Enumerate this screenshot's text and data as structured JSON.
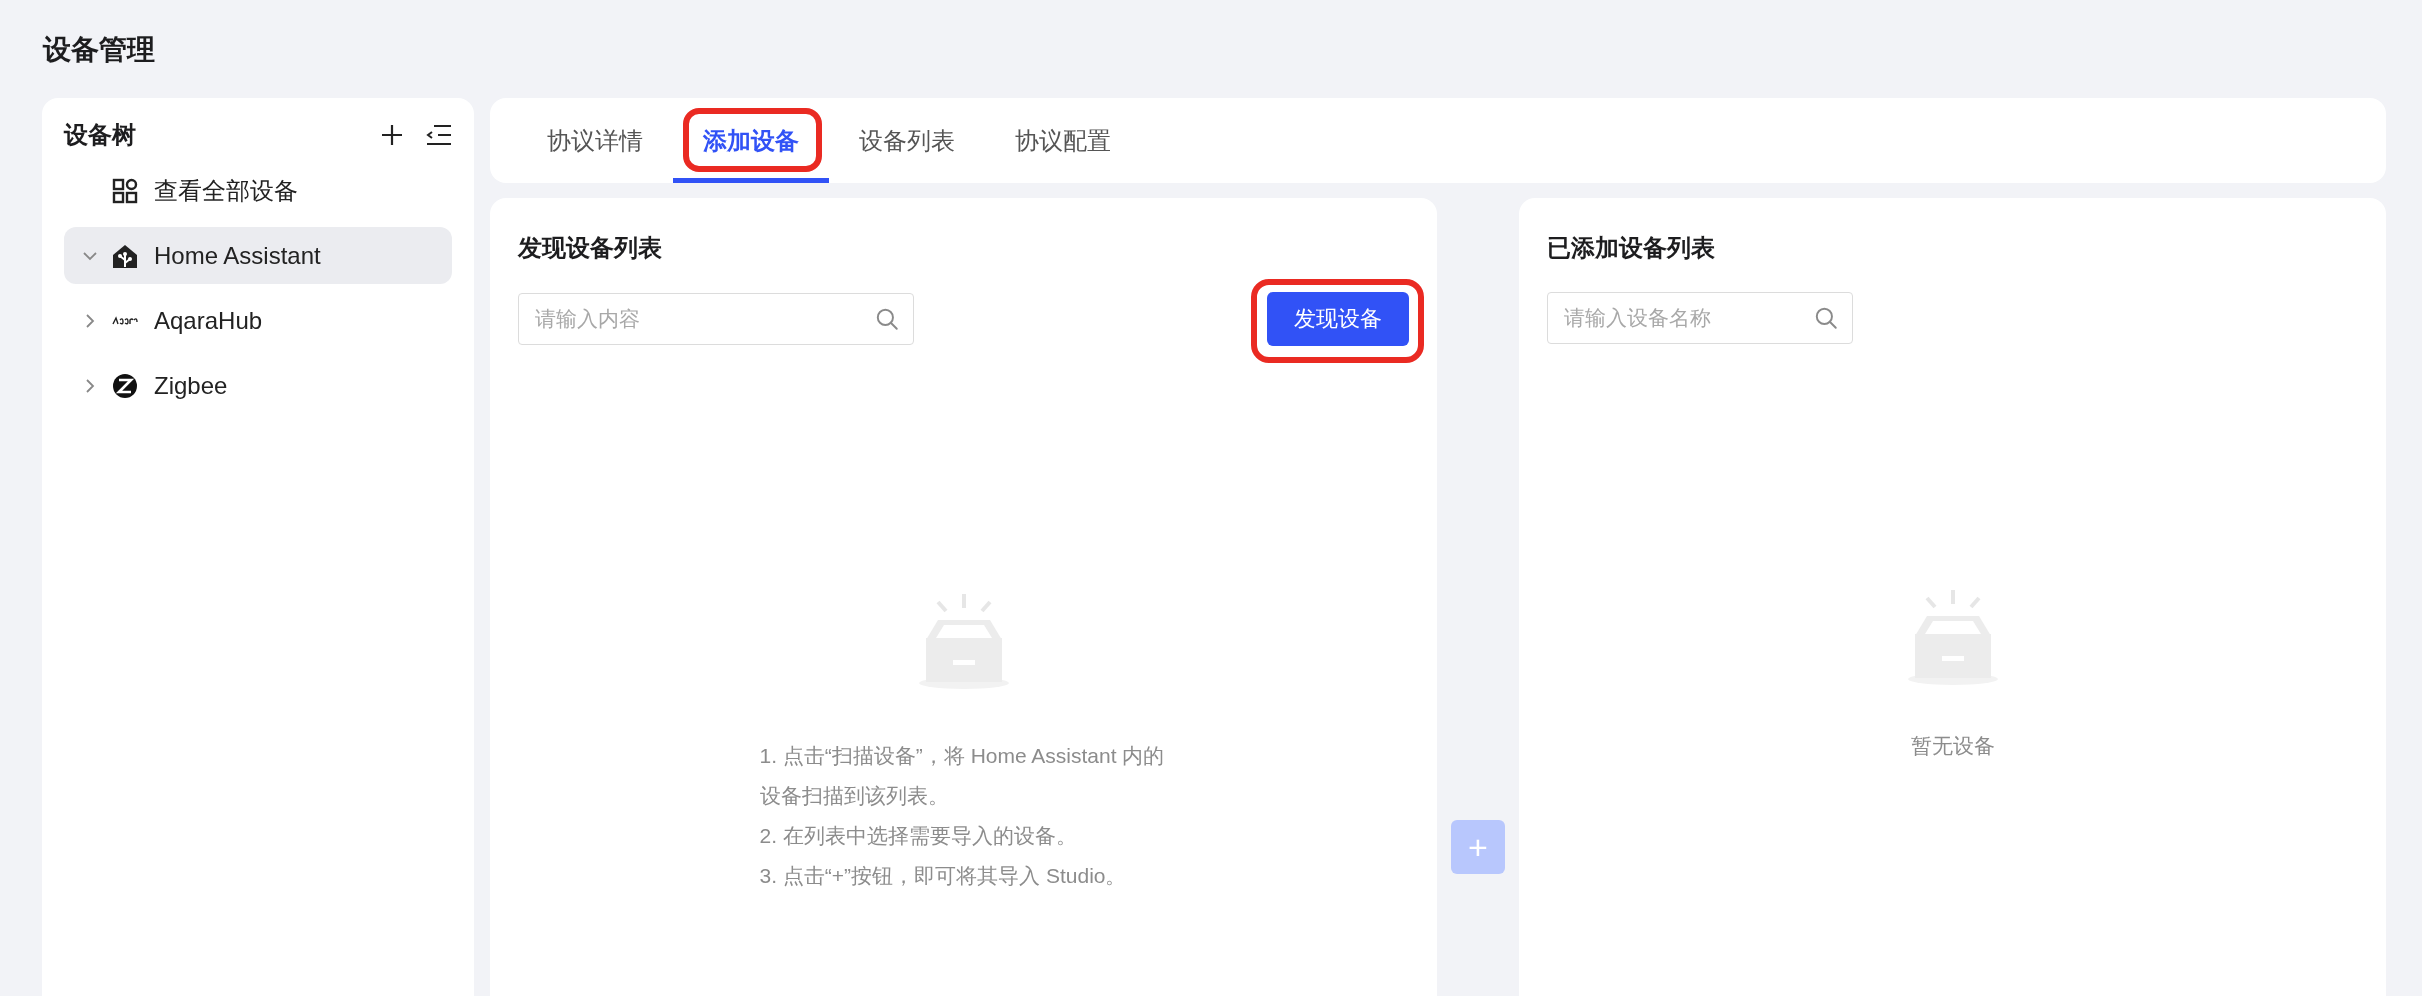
{
  "page_title": "设备管理",
  "sidebar": {
    "title": "设备树",
    "items": [
      {
        "kind": "all",
        "label": "查看全部设备",
        "selected": false
      },
      {
        "kind": "home",
        "label": "Home Assistant",
        "expanded": true,
        "selected": true
      },
      {
        "kind": "wave",
        "label": "AqaraHub",
        "expanded": false,
        "selected": false
      },
      {
        "kind": "disc",
        "label": "Zigbee",
        "expanded": false,
        "selected": false
      }
    ]
  },
  "tabs": [
    {
      "label": "协议详情",
      "selected": false,
      "highlighted": false
    },
    {
      "label": "添加设备",
      "selected": true,
      "highlighted": true
    },
    {
      "label": "设备列表",
      "selected": false,
      "highlighted": false
    },
    {
      "label": "协议配置",
      "selected": false,
      "highlighted": false
    }
  ],
  "discovered_panel": {
    "title": "发现设备列表",
    "search": {
      "placeholder": "请输入内容"
    },
    "discover_button": {
      "label": "发现设备",
      "highlighted": true
    },
    "empty_steps": [
      "1. 点击“扫描设备”，将 Home Assistant 内的设备扫描到该列表。",
      "2. 在列表中选择需要导入的设备。",
      "3. 点击“+”按钮，即可将其导入 Studio。"
    ]
  },
  "add_button": {
    "label": "+",
    "disabled": true
  },
  "added_panel": {
    "title": "已添加设备列表",
    "search": {
      "placeholder": "请输入设备名称"
    },
    "empty_text": "暂无设备"
  }
}
